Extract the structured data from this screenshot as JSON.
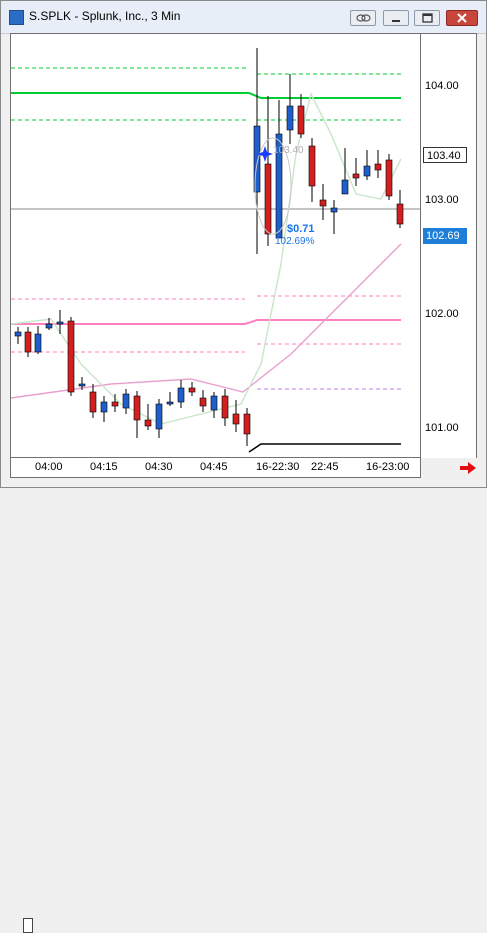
{
  "window": {
    "title": "S.SPLK - Splunk, Inc., 3 Min"
  },
  "price_axis": {
    "labels": [
      "104.00",
      "103.00",
      "102.00",
      "101.00"
    ],
    "current_price": "103.40",
    "last_price": "102.69"
  },
  "time_axis": {
    "labels": [
      "04:00",
      "04:15",
      "04:30",
      "04:45",
      "16-22:30",
      "22:45",
      "16-23:00"
    ]
  },
  "annotations": {
    "price_change": "$0.71",
    "overlay_text": "102.69%",
    "hover_value": "103.40"
  },
  "colors": {
    "up": "#1f5fcc",
    "down": "#d21f1f",
    "band": "#ff80c0",
    "green_line": "#00cc33",
    "ma": "#c8e6c8"
  },
  "icons": [
    "link-icon",
    "minimize-icon",
    "maximize-icon",
    "close-icon",
    "arrow-right-icon"
  ]
}
